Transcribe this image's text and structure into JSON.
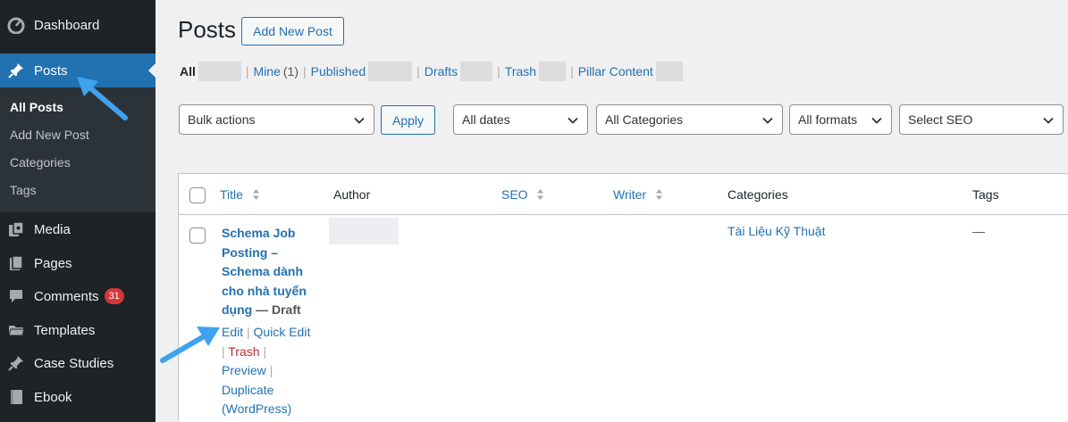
{
  "sidebar": {
    "items": [
      {
        "label": "Dashboard",
        "icon": "dashboard-icon"
      },
      {
        "label": "Posts",
        "icon": "pin-icon"
      },
      {
        "label": "Media",
        "icon": "media-icon"
      },
      {
        "label": "Pages",
        "icon": "pages-icon"
      },
      {
        "label": "Comments",
        "icon": "comments-icon",
        "badge": "31"
      },
      {
        "label": "Templates",
        "icon": "folder-icon"
      },
      {
        "label": "Case Studies",
        "icon": "pin-icon"
      },
      {
        "label": "Ebook",
        "icon": "book-icon"
      }
    ],
    "submenu": [
      "All Posts",
      "Add New Post",
      "Categories",
      "Tags"
    ]
  },
  "header": {
    "title": "Posts",
    "add_new_label": "Add New Post"
  },
  "views": {
    "all": "All",
    "mine": "Mine",
    "mine_count": "(1)",
    "published": "Published",
    "drafts": "Drafts",
    "trash": "Trash",
    "pillar": "Pillar Content"
  },
  "filters": {
    "bulk_actions": "Bulk actions",
    "apply": "Apply",
    "dates": "All dates",
    "categories": "All Categories",
    "formats": "All formats",
    "seo": "Select SEO"
  },
  "table": {
    "columns": {
      "title": "Title",
      "author": "Author",
      "seo": "SEO",
      "writer": "Writer",
      "categories": "Categories",
      "tags": "Tags"
    },
    "row": {
      "title": "Schema Job Posting – Schema dành cho nhà tuyển dụng",
      "state": "— Draft",
      "category": "Tài Liệu Kỹ Thuật",
      "tags": "—",
      "actions": {
        "edit": "Edit",
        "quick_edit": "Quick Edit",
        "trash": "Trash",
        "preview": "Preview",
        "duplicate": "Duplicate (WordPress)"
      }
    }
  },
  "colors": {
    "sidebar_bg": "#1d2327",
    "accent": "#2271b1",
    "annotation_arrow": "#3ea2ef",
    "trash": "#b32d2e",
    "badge": "#d63638"
  }
}
